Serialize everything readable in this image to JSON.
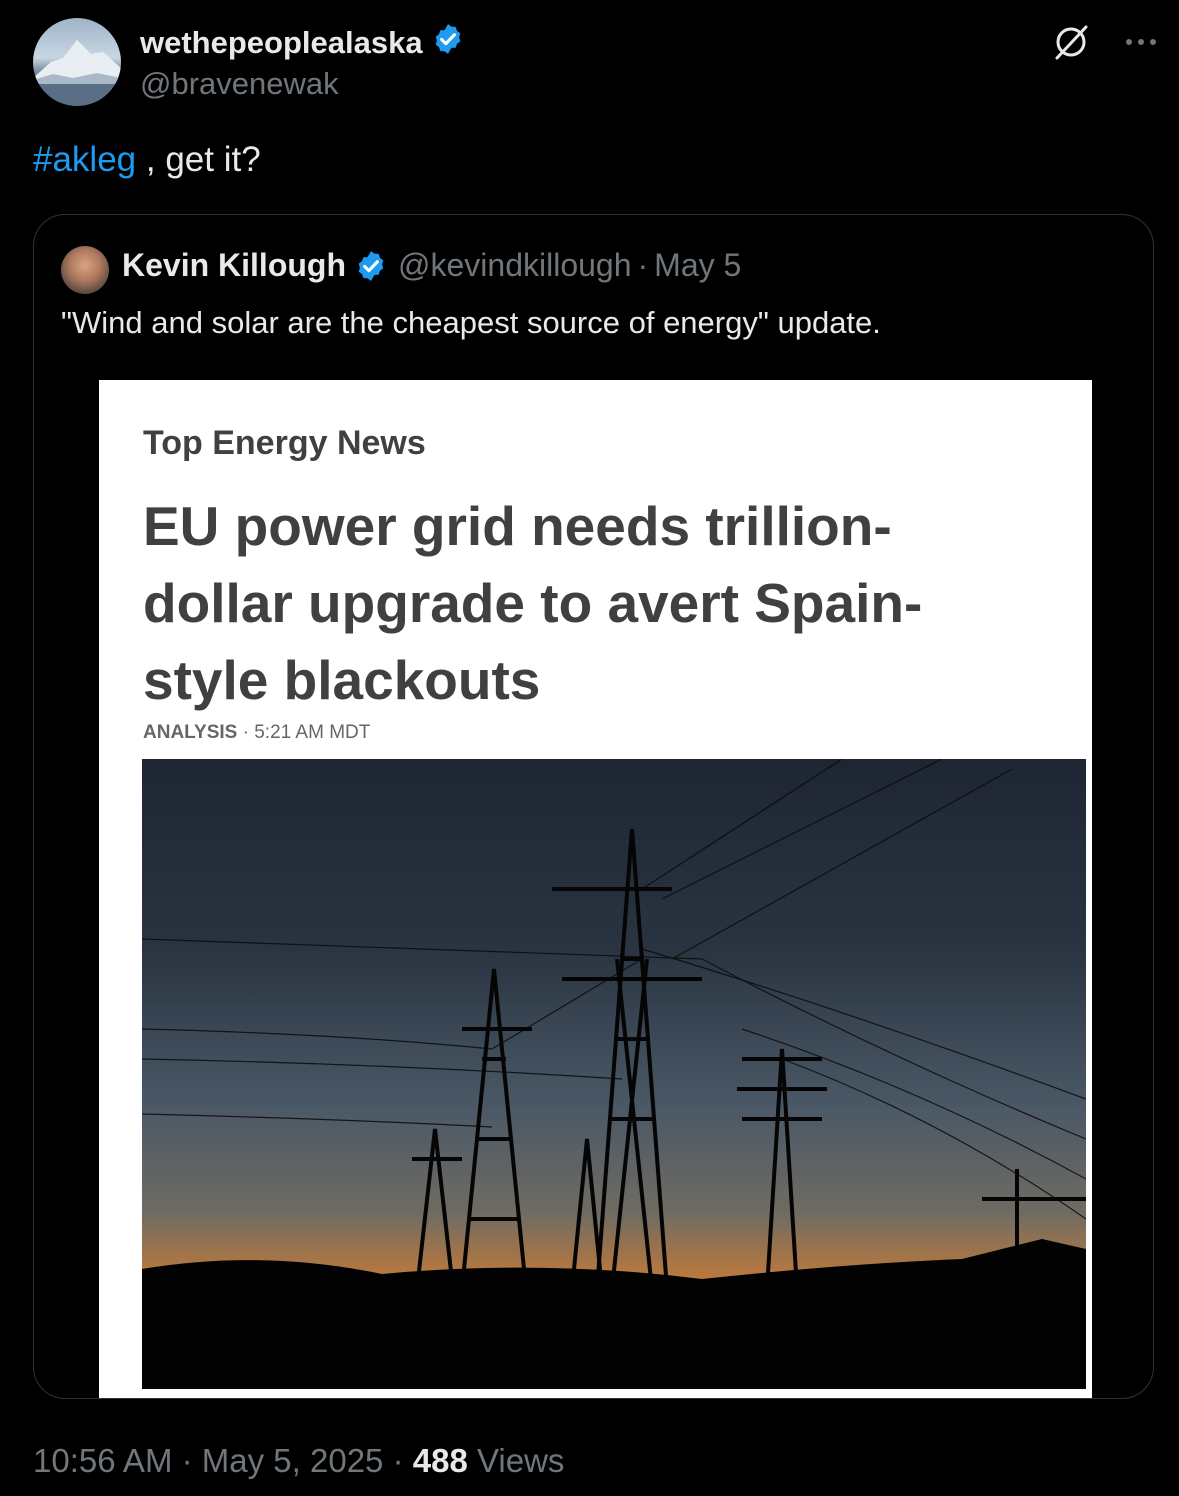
{
  "author": {
    "name": "wethepeoplealaska",
    "handle": "@bravenewak",
    "verified_icon": "verified-badge-icon"
  },
  "tweet": {
    "hashtag": "#akleg",
    "text": " , get it?"
  },
  "quoted": {
    "name": "Kevin Killough",
    "handle": "@kevindkillough",
    "date": "May 5",
    "text": "\"Wind and solar are the cheapest source of energy\" update."
  },
  "article": {
    "section": "Top Energy News",
    "headline_line1": "EU power grid needs trillion-",
    "headline_line2": "dollar upgrade to avert Spain-",
    "headline_line3": "style blackouts",
    "kind": "ANALYSIS",
    "time": "5:21 AM MDT"
  },
  "footer": {
    "time": "10:56 AM",
    "date": "May 5, 2025",
    "views_count": "488",
    "views_label": "Views"
  },
  "colors": {
    "link": "#1d9bf0",
    "muted": "#71767b",
    "text": "#e7e9ea",
    "background": "#000000"
  }
}
